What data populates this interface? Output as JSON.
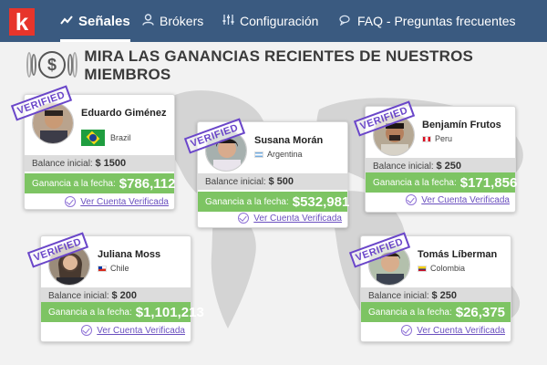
{
  "brand": {
    "logo_letter": "k",
    "colors": {
      "nav": "#3a5a80",
      "logo": "#e7352b",
      "gain": "#7dc463",
      "link": "#6a4fbf"
    }
  },
  "nav": {
    "items": [
      {
        "label": "Señales",
        "icon": "chart-line-icon",
        "active": true
      },
      {
        "label": "Brókers",
        "icon": "user-icon",
        "active": false
      },
      {
        "label": "Configuración",
        "icon": "sliders-icon",
        "active": false
      },
      {
        "label": "FAQ - Preguntas frecuentes",
        "icon": "chat-bubbles-icon",
        "active": false
      }
    ]
  },
  "section": {
    "title": "MIRA LAS GANANCIAS RECIENTES DE NUESTROS MIEMBROS",
    "icon": "dollar-coin-icon"
  },
  "labels": {
    "stamp": "VERIFIED",
    "balance": "Balance inicial:",
    "gain": "Ganancia a la fecha:",
    "verify_link": "Ver Cuenta Verificada"
  },
  "members": [
    {
      "name": "Eduardo Giménez",
      "country": "Brazil",
      "flag": "brazil-flag-icon",
      "balance": "$ 1500",
      "gain": "$786,112"
    },
    {
      "name": "Susana Morán",
      "country": "Argentina",
      "flag": "argentina-flag-icon",
      "balance": "$ 500",
      "gain": "$532,981"
    },
    {
      "name": "Benjamín Frutos",
      "country": "Peru",
      "flag": "peru-flag-icon",
      "balance": "$ 250",
      "gain": "$171,856"
    },
    {
      "name": "Juliana Moss",
      "country": "Chile",
      "flag": "chile-flag-icon",
      "balance": "$ 200",
      "gain": "$1,101,213"
    },
    {
      "name": "Tomás Líberman",
      "country": "Colombia",
      "flag": "colombia-flag-icon",
      "balance": "$ 250",
      "gain": "$26,375"
    }
  ]
}
